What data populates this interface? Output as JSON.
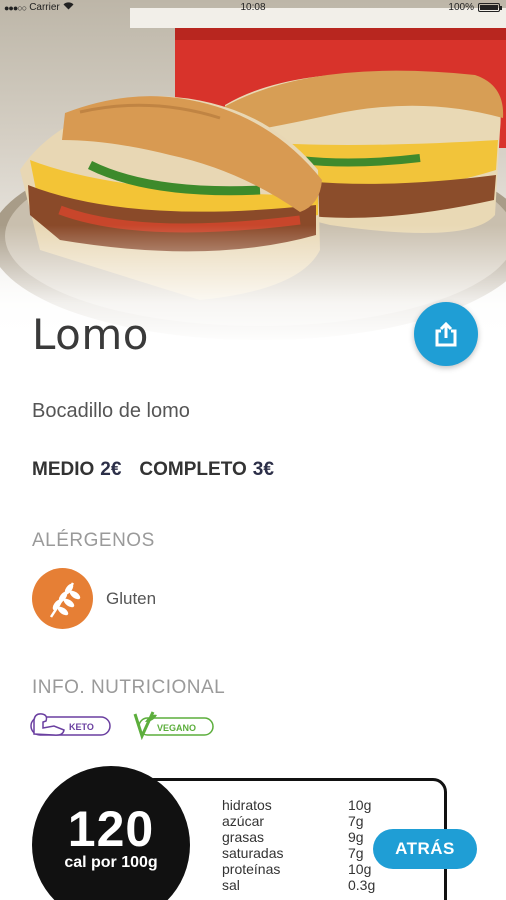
{
  "status_bar": {
    "carrier": "Carrier",
    "time": "10:08",
    "battery": "100%"
  },
  "hero": {
    "image": "sandwich-photo"
  },
  "product": {
    "title": "Lomo",
    "description": "Bocadillo de lomo",
    "prices": [
      {
        "label": "MEDIO",
        "amount": "2€"
      },
      {
        "label": "COMPLETO",
        "amount": "3€"
      }
    ]
  },
  "allergens": {
    "heading": "ALÉRGENOS",
    "items": [
      {
        "label": "Gluten",
        "icon": "wheat-icon",
        "color": "#e67f35"
      }
    ]
  },
  "nutrition": {
    "heading": "INFO. NUTRICIONAL",
    "badges": [
      {
        "label": "KETO",
        "icon": "keto-arm-icon",
        "color": "#6a3fa0"
      },
      {
        "label": "VEGANO",
        "icon": "vegan-v-icon",
        "color": "#5cae3c"
      }
    ],
    "calories": "120",
    "calories_unit": "cal por 100g",
    "rows": [
      {
        "name": "hidratos",
        "value": "10g"
      },
      {
        "name": "azúcar",
        "value": "7g"
      },
      {
        "name": "grasas",
        "value": "9g"
      },
      {
        "name": "saturadas",
        "value": "7g"
      },
      {
        "name": "proteínas",
        "value": "10g"
      },
      {
        "name": "sal",
        "value": "0.3g"
      }
    ]
  },
  "actions": {
    "share_icon": "share-icon",
    "back_label": "ATRÁS",
    "accent": "#1f9ed5"
  }
}
